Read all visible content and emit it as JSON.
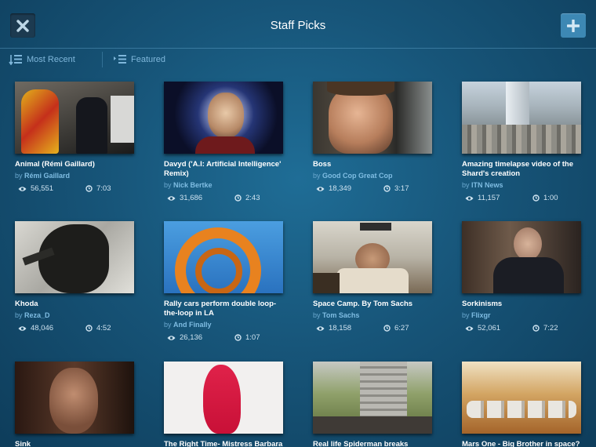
{
  "header": {
    "title": "Staff Picks"
  },
  "sort": {
    "recent_label": "Most Recent",
    "featured_label": "Featured"
  },
  "videos": [
    {
      "title": "Animal (Rémi Gaillard)",
      "by": "by",
      "author": "Rémi Gaillard",
      "plays": "56,551",
      "duration": "7:03"
    },
    {
      "title": "Davyd ('A.I: Artificial Intelligence' Remix)",
      "by": "by",
      "author": "Nick Bertke",
      "plays": "31,686",
      "duration": "2:43"
    },
    {
      "title": "Boss",
      "by": "by",
      "author": "Good Cop Great Cop",
      "plays": "18,349",
      "duration": "3:17"
    },
    {
      "title": "Amazing timelapse video of the Shard's creation",
      "by": "by",
      "author": "ITN News",
      "plays": "11,157",
      "duration": "1:00"
    },
    {
      "title": "Khoda",
      "by": "by",
      "author": "Reza_D",
      "plays": "48,046",
      "duration": "4:52"
    },
    {
      "title": "Rally cars perform double loop-the-loop in LA",
      "by": "by",
      "author": "And Finally",
      "plays": "26,136",
      "duration": "1:07"
    },
    {
      "title": "Space Camp. By Tom Sachs",
      "by": "by",
      "author": "Tom Sachs",
      "plays": "18,158",
      "duration": "6:27"
    },
    {
      "title": "Sorkinisms",
      "by": "by",
      "author": "Flixgr",
      "plays": "52,061",
      "duration": "7:22"
    },
    {
      "title": "Sink",
      "by": "",
      "author": "",
      "plays": "",
      "duration": ""
    },
    {
      "title": "The Right Time- Mistress Barbara",
      "by": "",
      "author": "",
      "plays": "",
      "duration": ""
    },
    {
      "title": "Real life Spiderman breaks vertical",
      "by": "",
      "author": "",
      "plays": "",
      "duration": ""
    },
    {
      "title": "Mars One - Big Brother in space?",
      "by": "",
      "author": "",
      "plays": "",
      "duration": ""
    }
  ]
}
